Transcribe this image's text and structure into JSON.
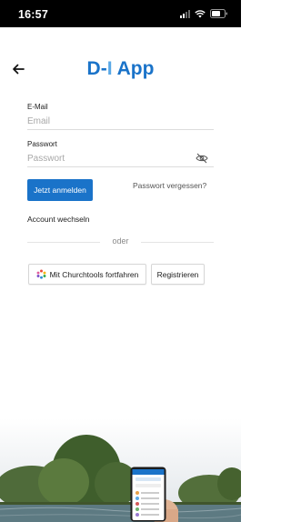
{
  "status_bar": {
    "time": "16:57"
  },
  "header": {
    "title_prefix": "D",
    "title_dash": "-",
    "title_bar": "I",
    "title_suffix": " App"
  },
  "form": {
    "email_label": "E-Mail",
    "email_placeholder": "Email",
    "password_label": "Passwort",
    "password_placeholder": "Passwort",
    "login_button": "Jetzt anmelden",
    "forgot_password": "Passwort vergessen?",
    "switch_account": "Account wechseln",
    "divider_text": "oder",
    "churchtools_button": "Mit Churchtools fortfahren",
    "register_button": "Registrieren"
  },
  "colors": {
    "primary": "#1a73c9",
    "status_bar_bg": "#000000",
    "background": "#ffffff"
  },
  "icons": {
    "back": "arrow-left-icon",
    "password_toggle": "eye-off-icon",
    "churchtools": "churchtools-logo-icon"
  }
}
